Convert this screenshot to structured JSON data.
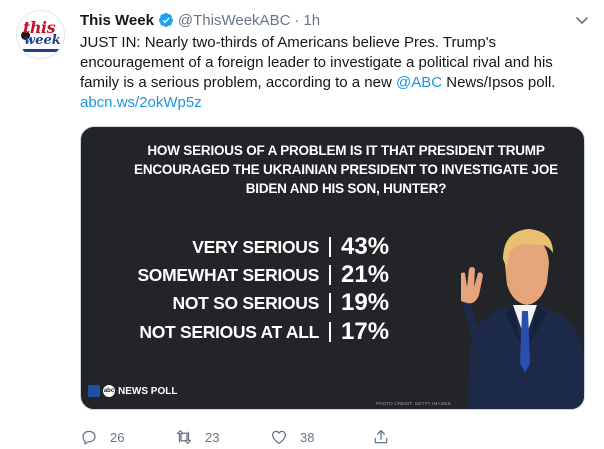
{
  "tweet": {
    "display_name": "This Week",
    "handle": "@ThisWeekABC",
    "separator": "·",
    "time": "1h",
    "text_main": "JUST IN: Nearly two-thirds of Americans believe Pres. Trump's encouragement of a foreign leader to investigate a political rival and his family is a serious problem, according to a new ",
    "mention": "@ABC",
    "text_after": " News/Ipsos poll. ",
    "url": "abcn.ws/2okWp5z"
  },
  "avatar": {
    "brand_top": "this",
    "brand_bottom": "week"
  },
  "card": {
    "question": "How serious of a problem is it that President Trump encouraged the Ukrainian president to investigate Joe Biden and his son, Hunter?",
    "rows": [
      {
        "label": "VERY SERIOUS",
        "value": "43%"
      },
      {
        "label": "SOMEWHAT SERIOUS",
        "value": "21%"
      },
      {
        "label": "NOT SO SERIOUS",
        "value": "19%"
      },
      {
        "label": "NOT SERIOUS AT ALL",
        "value": "17%"
      }
    ],
    "footer_logo": "NEWS POLL",
    "photo_credit": "PHOTO CREDIT: GETTY IMAGES"
  },
  "actions": {
    "replies": "26",
    "retweets": "23",
    "likes": "38"
  },
  "colors": {
    "link": "#1b95e0",
    "verified": "#1da1f2",
    "card_bg": "#222428",
    "meta": "#657786"
  },
  "icons": [
    "verified-badge-icon",
    "chevron-down-icon",
    "reply-icon",
    "retweet-icon",
    "like-icon",
    "share-icon"
  ]
}
